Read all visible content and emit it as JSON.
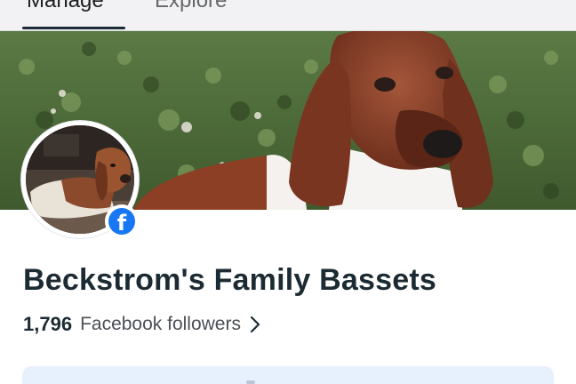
{
  "tabs": [
    {
      "label": "Manage",
      "active": true
    },
    {
      "label": "Explore",
      "active": false
    }
  ],
  "page": {
    "name": "Beckstrom's Family Bassets",
    "followers_count": "1,796",
    "followers_label": "Facebook followers"
  },
  "icons": {
    "badge": "facebook-logo-icon",
    "followers_arrow": "chevron-right-icon"
  },
  "colors": {
    "facebook_blue": "#1877f2",
    "text_primary": "#1c2b33",
    "text_secondary": "#4b4f56",
    "card_background": "#e7f0fd"
  }
}
